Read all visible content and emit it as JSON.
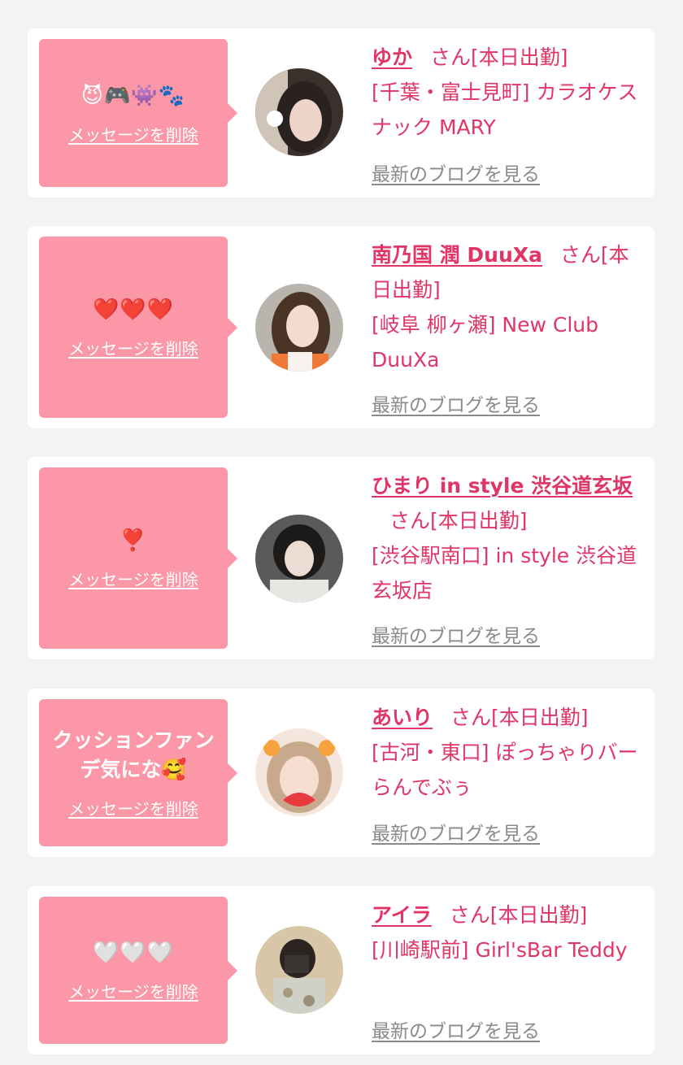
{
  "delete_label": "メッセージを削除",
  "blog_label": "最新のブログを見る",
  "colors": {
    "background": "#f3f3f3",
    "card": "#ffffff",
    "bubble": "#fb97a7",
    "accent_text": "#e13467",
    "link_gray": "#8a8a8a"
  },
  "items": [
    {
      "message": "😈🎮👾🐾",
      "name": "ゆか",
      "suffix": "さん[本日出勤]",
      "shop": "[千葉・富士見町] カラオケスナック MARY",
      "avatar_icon": "avatar-photo"
    },
    {
      "message": "❤️❤️❤️",
      "name": "南乃国 潤 DuuXa",
      "suffix": "さん[本日出勤]",
      "shop": "[岐阜 柳ヶ瀬] New Club DuuXa",
      "avatar_icon": "avatar-photo"
    },
    {
      "message": "❣️",
      "name": "ひまり in style 渋谷道玄坂",
      "suffix": "さん[本日出勤]",
      "shop": "[渋谷駅南口] in style 渋谷道玄坂店",
      "avatar_icon": "avatar-photo"
    },
    {
      "message": "クッションファンデ気にな🥰",
      "name": "あいり",
      "suffix": "さん[本日出勤]",
      "shop": "[古河・東口] ぽっちゃりバー らんでぶぅ",
      "avatar_icon": "avatar-photo"
    },
    {
      "message": "🤍🤍🤍",
      "name": "アイラ",
      "suffix": "さん[本日出勤]",
      "shop": "[川崎駅前] Girl'sBar Teddy",
      "avatar_icon": "avatar-photo"
    }
  ]
}
